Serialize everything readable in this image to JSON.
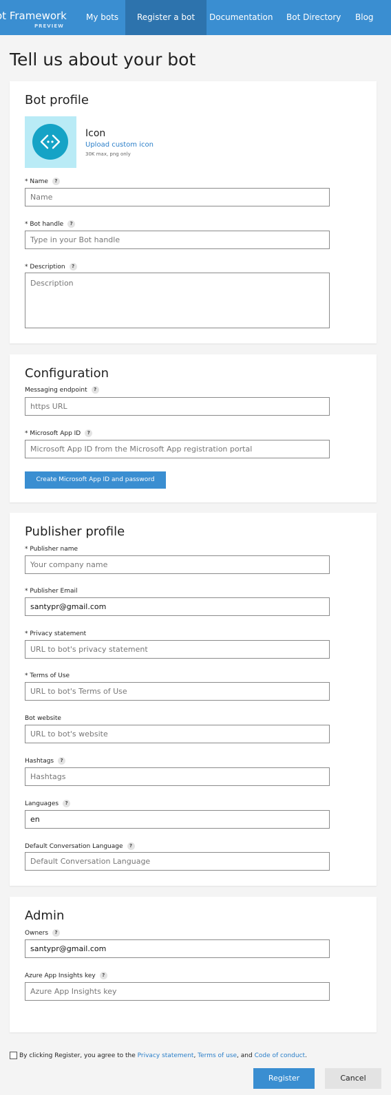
{
  "nav": {
    "brand": "ot Framework",
    "brand_sub": "PREVIEW",
    "items": [
      {
        "label": "My bots"
      },
      {
        "label": "Register a bot"
      },
      {
        "label": "Documentation"
      },
      {
        "label": "Bot Directory"
      },
      {
        "label": "Blog"
      }
    ],
    "active_color": "#2d73ad",
    "bar_color": "#3a8ed1"
  },
  "page_title": "Tell us about your bot",
  "bot_profile": {
    "heading": "Bot profile",
    "icon_label": "Icon",
    "icon_link": "Upload custom icon",
    "icon_note": "30K max, png only",
    "name_label": "Name",
    "name_placeholder": "Name",
    "handle_label": "Bot handle",
    "handle_placeholder": "Type in your Bot handle",
    "description_label": "Description",
    "description_placeholder": "Description"
  },
  "configuration": {
    "heading": "Configuration",
    "endpoint_label": "Messaging endpoint",
    "endpoint_placeholder": "https URL",
    "appid_label": "Microsoft App ID",
    "appid_placeholder": "Microsoft App ID from the Microsoft App registration portal",
    "create_button": "Create Microsoft App ID and password"
  },
  "publisher": {
    "heading": "Publisher profile",
    "pub_name_label": "Publisher name",
    "pub_name_placeholder": "Your company name",
    "pub_email_label": "Publisher Email",
    "pub_email_value": "santypr@gmail.com",
    "privacy_label": "Privacy statement",
    "privacy_placeholder": "URL to bot's privacy statement",
    "terms_label": "Terms of Use",
    "terms_placeholder": "URL to bot's Terms of Use",
    "website_label": "Bot website",
    "website_placeholder": "URL to bot's website",
    "hashtags_label": "Hashtags",
    "hashtags_placeholder": "Hashtags",
    "languages_label": "Languages",
    "languages_value": "en",
    "default_lang_label": "Default Conversation Language",
    "default_lang_placeholder": "Default Conversation Language"
  },
  "admin": {
    "heading": "Admin",
    "owners_label": "Owners",
    "owners_value": "santypr@gmail.com",
    "insights_label": "Azure App Insights key",
    "insights_placeholder": "Azure App Insights key"
  },
  "agreement": {
    "prefix": "By clicking Register, you agree to the",
    "privacy_link": "Privacy statement",
    "terms_link": "Terms of use",
    "and": "and",
    "conduct_link": "Code of conduct",
    "checked": false
  },
  "footer": {
    "register": "Register",
    "cancel": "Cancel"
  },
  "help_glyph": "?",
  "required_mark": "*"
}
